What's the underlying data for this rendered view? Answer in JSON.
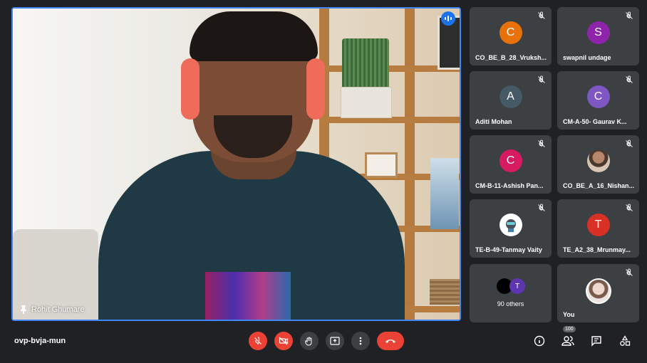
{
  "presenter": {
    "name": "Rohit Ghumare"
  },
  "meeting_code": "ovp-bvja-mun",
  "participants": [
    {
      "name": "CO_BE_B_28_Vruksh...",
      "initial": "C",
      "color": "#e8710a",
      "muted": true
    },
    {
      "name": "swapnil undage",
      "initial": "S",
      "color": "#8e24aa",
      "muted": true
    },
    {
      "name": "Aditi Mohan",
      "initial": "A",
      "color": "#455a64",
      "muted": true
    },
    {
      "name": "CM-A-50- Gaurav K...",
      "initial": "C",
      "color": "#7e57c2",
      "muted": true
    },
    {
      "name": "CM-B-11-Ashish Pan...",
      "initial": "C",
      "color": "#d81b60",
      "muted": true
    },
    {
      "name": "CO_BE_A_16_Nishan...",
      "initial": "",
      "color": "",
      "muted": true
    },
    {
      "name": "TE-B-49-Tanmay Vaity",
      "initial": "",
      "color": "",
      "muted": true
    },
    {
      "name": "TE_A2_38_Mrunmay...",
      "initial": "T",
      "color": "#d93025",
      "muted": true
    }
  ],
  "others": {
    "label": "90 others",
    "initial": "T",
    "color": "#5e35b1"
  },
  "self": {
    "name": "You",
    "muted": true
  },
  "people_count": "100",
  "colors": {
    "background": "#202124",
    "tile": "#3c4043",
    "accent": "#1a73e8",
    "danger": "#ea4335"
  },
  "icons": {
    "mic": "mic-off-icon",
    "camera": "camera-off-icon",
    "hand": "raise-hand-icon",
    "present": "present-icon",
    "more": "more-vert-icon",
    "end": "end-call-icon",
    "info": "info-icon",
    "people": "people-icon",
    "chat": "chat-icon",
    "activities": "activities-icon"
  }
}
